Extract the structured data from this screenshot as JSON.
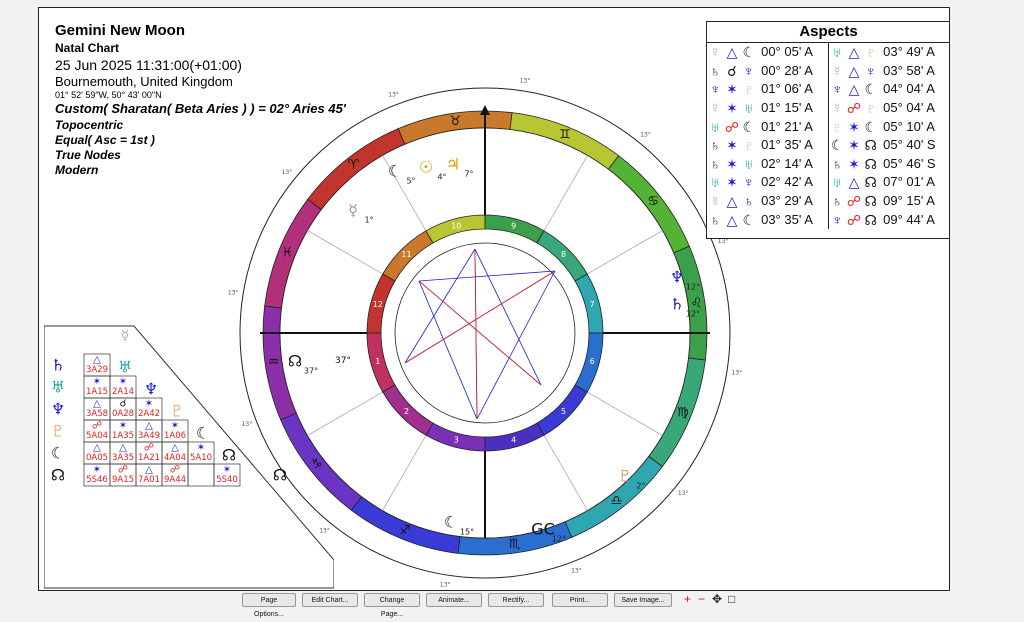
{
  "header": {
    "title": "Gemini New Moon",
    "subtitle": "Natal Chart",
    "datetime": "25 Jun 2025 11:31:00(+01:00)",
    "location": "Bournemouth, United Kingdom",
    "coords": "01° 52' 59\"W, 50° 43' 00\"N",
    "ayanamsa": "Custom( Sharatan( Beta Aries ) ) = 02° Aries 45'",
    "settings": [
      "Topocentric",
      "Equal( Asc = 1st )",
      "True Nodes",
      "Modern"
    ]
  },
  "aspects": {
    "title": "Aspects",
    "colors": {
      "blue": "#1a1ad8",
      "red": "#e02020",
      "black": "#111111",
      "teal": "#22aaa8",
      "gray": "#b0b0b0",
      "peach": "#f0b080",
      "navy": "#1a1a8a"
    },
    "rows": [
      [
        {
          "p1": "☿",
          "c1": "gray",
          "a": "△",
          "ca": "blue",
          "p2": "☾",
          "c2": "black",
          "v": "00° 05' A"
        },
        {
          "p1": "♅",
          "c1": "teal",
          "a": "△",
          "ca": "blue",
          "p2": "♇",
          "c2": "peach",
          "v": "03° 49' A"
        }
      ],
      [
        {
          "p1": "♄",
          "c1": "navy",
          "a": "☌",
          "ca": "black",
          "p2": "♆",
          "c2": "blue",
          "v": "00° 28' A"
        },
        {
          "p1": "☿",
          "c1": "gray",
          "a": "△",
          "ca": "blue",
          "p2": "♆",
          "c2": "blue",
          "v": "03° 58' A"
        }
      ],
      [
        {
          "p1": "♆",
          "c1": "blue",
          "a": "✶",
          "ca": "blue",
          "p2": "♇",
          "c2": "peach",
          "v": "01° 06' A"
        },
        {
          "p1": "♆",
          "c1": "blue",
          "a": "△",
          "ca": "blue",
          "p2": "☾",
          "c2": "black",
          "v": "04° 04' A"
        }
      ],
      [
        {
          "p1": "☿",
          "c1": "gray",
          "a": "✶",
          "ca": "blue",
          "p2": "♅",
          "c2": "teal",
          "v": "01° 15' A"
        },
        {
          "p1": "☿",
          "c1": "gray",
          "a": "☍",
          "ca": "red",
          "p2": "♇",
          "c2": "peach",
          "v": "05° 04' A"
        }
      ],
      [
        {
          "p1": "♅",
          "c1": "teal",
          "a": "☍",
          "ca": "red",
          "p2": "☾",
          "c2": "black",
          "v": "01° 21' A"
        },
        {
          "p1": "♇",
          "c1": "peach",
          "a": "✶",
          "ca": "blue",
          "p2": "☾",
          "c2": "black",
          "v": "05° 10' A"
        }
      ],
      [
        {
          "p1": "♄",
          "c1": "navy",
          "a": "✶",
          "ca": "blue",
          "p2": "♇",
          "c2": "peach",
          "v": "01° 35' A"
        },
        {
          "p1": "☾",
          "c1": "black",
          "a": "✶",
          "ca": "blue",
          "p2": "☊",
          "c2": "black",
          "v": "05° 40' S"
        }
      ],
      [
        {
          "p1": "♄",
          "c1": "navy",
          "a": "✶",
          "ca": "blue",
          "p2": "♅",
          "c2": "teal",
          "v": "02° 14' A"
        },
        {
          "p1": "♄",
          "c1": "navy",
          "a": "✶",
          "ca": "blue",
          "p2": "☊",
          "c2": "black",
          "v": "05° 46' S"
        }
      ],
      [
        {
          "p1": "♅",
          "c1": "teal",
          "a": "✶",
          "ca": "blue",
          "p2": "♆",
          "c2": "blue",
          "v": "02° 42' A"
        },
        {
          "p1": "♅",
          "c1": "teal",
          "a": "△",
          "ca": "blue",
          "p2": "☊",
          "c2": "black",
          "v": "07° 01' A"
        }
      ],
      [
        {
          "p1": "☿",
          "c1": "gray",
          "a": "△",
          "ca": "blue",
          "p2": "♄",
          "c2": "navy",
          "v": "03° 29' A"
        },
        {
          "p1": "♄",
          "c1": "navy",
          "a": "☍",
          "ca": "red",
          "p2": "☊",
          "c2": "black",
          "v": "09° 15' A"
        }
      ],
      [
        {
          "p1": "♄",
          "c1": "navy",
          "a": "△",
          "ca": "blue",
          "p2": "☾",
          "c2": "black",
          "v": "03° 35' A"
        },
        {
          "p1": "♆",
          "c1": "blue",
          "a": "☍",
          "ca": "red",
          "p2": "☊",
          "c2": "black",
          "v": "09° 44' A"
        }
      ]
    ]
  },
  "grid": {
    "planets": [
      {
        "sym": "☿",
        "color": "gray"
      },
      {
        "sym": "♄",
        "color": "navy"
      },
      {
        "sym": "♅",
        "color": "teal"
      },
      {
        "sym": "♆",
        "color": "blue"
      },
      {
        "sym": "♇",
        "color": "peach"
      },
      {
        "sym": "☾",
        "color": "black"
      },
      {
        "sym": "☊",
        "color": "black"
      }
    ],
    "cells": [
      [
        {
          "a": "△",
          "t": "3A29",
          "c": "blue"
        }
      ],
      [
        {
          "a": "✶",
          "t": "1A15",
          "c": "blue"
        },
        {
          "a": "✶",
          "t": "2A14",
          "c": "blue"
        }
      ],
      [
        {
          "a": "△",
          "t": "3A58",
          "c": "blue"
        },
        {
          "a": "☌",
          "t": "0A28",
          "c": "black"
        },
        {
          "a": "✶",
          "t": "2A42",
          "c": "blue"
        }
      ],
      [
        {
          "a": "☍",
          "t": "5A04",
          "c": "red"
        },
        {
          "a": "✶",
          "t": "1A35",
          "c": "blue"
        },
        {
          "a": "△",
          "t": "3A49",
          "c": "blue"
        },
        {
          "a": "✶",
          "t": "1A06",
          "c": "blue"
        }
      ],
      [
        {
          "a": "△",
          "t": "0A05",
          "c": "blue"
        },
        {
          "a": "△",
          "t": "3A35",
          "c": "blue"
        },
        {
          "a": "☍",
          "t": "1A21",
          "c": "red"
        },
        {
          "a": "△",
          "t": "4A04",
          "c": "blue"
        },
        {
          "a": "✶",
          "t": "5A10",
          "c": "blue"
        }
      ],
      [
        {
          "a": "✶",
          "t": "5S46",
          "c": "blue"
        },
        {
          "a": "☍",
          "t": "9A15",
          "c": "red"
        },
        {
          "a": "△",
          "t": "7A01",
          "c": "blue"
        },
        {
          "a": "☍",
          "t": "9A44",
          "c": "red"
        },
        {
          "a": "",
          "t": "",
          "c": "blue"
        },
        {
          "a": "✶",
          "t": "5S40",
          "c": "blue"
        }
      ]
    ]
  },
  "wheel": {
    "signs": [
      {
        "sym": "♈",
        "color": "#c2342e"
      },
      {
        "sym": "♉",
        "color": "#c9792b"
      },
      {
        "sym": "♊",
        "color": "#b8c634"
      },
      {
        "sym": "♋",
        "color": "#54b234"
      },
      {
        "sym": "♌",
        "color": "#3aa04a"
      },
      {
        "sym": "♍",
        "color": "#39a878"
      },
      {
        "sym": "♎",
        "color": "#2fa6b0"
      },
      {
        "sym": "♏",
        "color": "#2a6fd0"
      },
      {
        "sym": "♐",
        "color": "#3a3ad6"
      },
      {
        "sym": "♑",
        "color": "#6b34c4"
      },
      {
        "sym": "♒",
        "color": "#8a2fa8"
      },
      {
        "sym": "♓",
        "color": "#b2307a"
      }
    ],
    "houses": [
      {
        "n": "1",
        "color": "#c2342e"
      },
      {
        "n": "2",
        "color": "#c9792b"
      },
      {
        "n": "3",
        "color": "#b8c634"
      },
      {
        "n": "4",
        "color": "#3aa04a"
      },
      {
        "n": "5",
        "color": "#39a878"
      },
      {
        "n": "6",
        "color": "#2fa6b0"
      },
      {
        "n": "7",
        "color": "#2a6fd0"
      },
      {
        "n": "8",
        "color": "#3a3ad6"
      },
      {
        "n": "9",
        "color": "#4a2fc0"
      },
      {
        "n": "10",
        "color": "#7a2fb8"
      },
      {
        "n": "11",
        "color": "#a12f90"
      },
      {
        "n": "12",
        "color": "#c23060"
      }
    ],
    "asc_label": "37°",
    "outer_markers": [
      "13°",
      "13°",
      "13°",
      "13°",
      "13°",
      "13°",
      "13°",
      "13°",
      "13°",
      "13°",
      "13°",
      "13°"
    ],
    "planet_labels": [
      {
        "sym": "☾",
        "deg": "5°",
        "color": "#111111"
      },
      {
        "sym": "☉",
        "deg": "4°",
        "color": "#d4a000"
      },
      {
        "sym": "♃",
        "deg": "7°",
        "color": "#d4a000"
      },
      {
        "sym": "☿",
        "deg": "1°",
        "color": "#999999"
      },
      {
        "sym": "♆",
        "deg": "12°",
        "color": "#1a1ad8"
      },
      {
        "sym": "♄",
        "deg": "12°",
        "color": "#1a1a8a"
      },
      {
        "sym": "♇",
        "deg": "2°",
        "color": "#e0a070"
      },
      {
        "sym": "☾",
        "deg": "15°",
        "color": "#111111"
      },
      {
        "sym": "☊",
        "deg": "37°",
        "color": "#111111"
      },
      {
        "sym": "GC",
        "deg": "12°",
        "color": "#111111"
      }
    ]
  },
  "toolbar": {
    "buttons": [
      "Page Options...",
      "Edit Chart...",
      "Change Page...",
      "Animate...",
      "Rectify...",
      "Print...",
      "Save Image..."
    ],
    "zoom_in": "+",
    "zoom_out": "−",
    "pan": "✥",
    "fit": "□"
  }
}
